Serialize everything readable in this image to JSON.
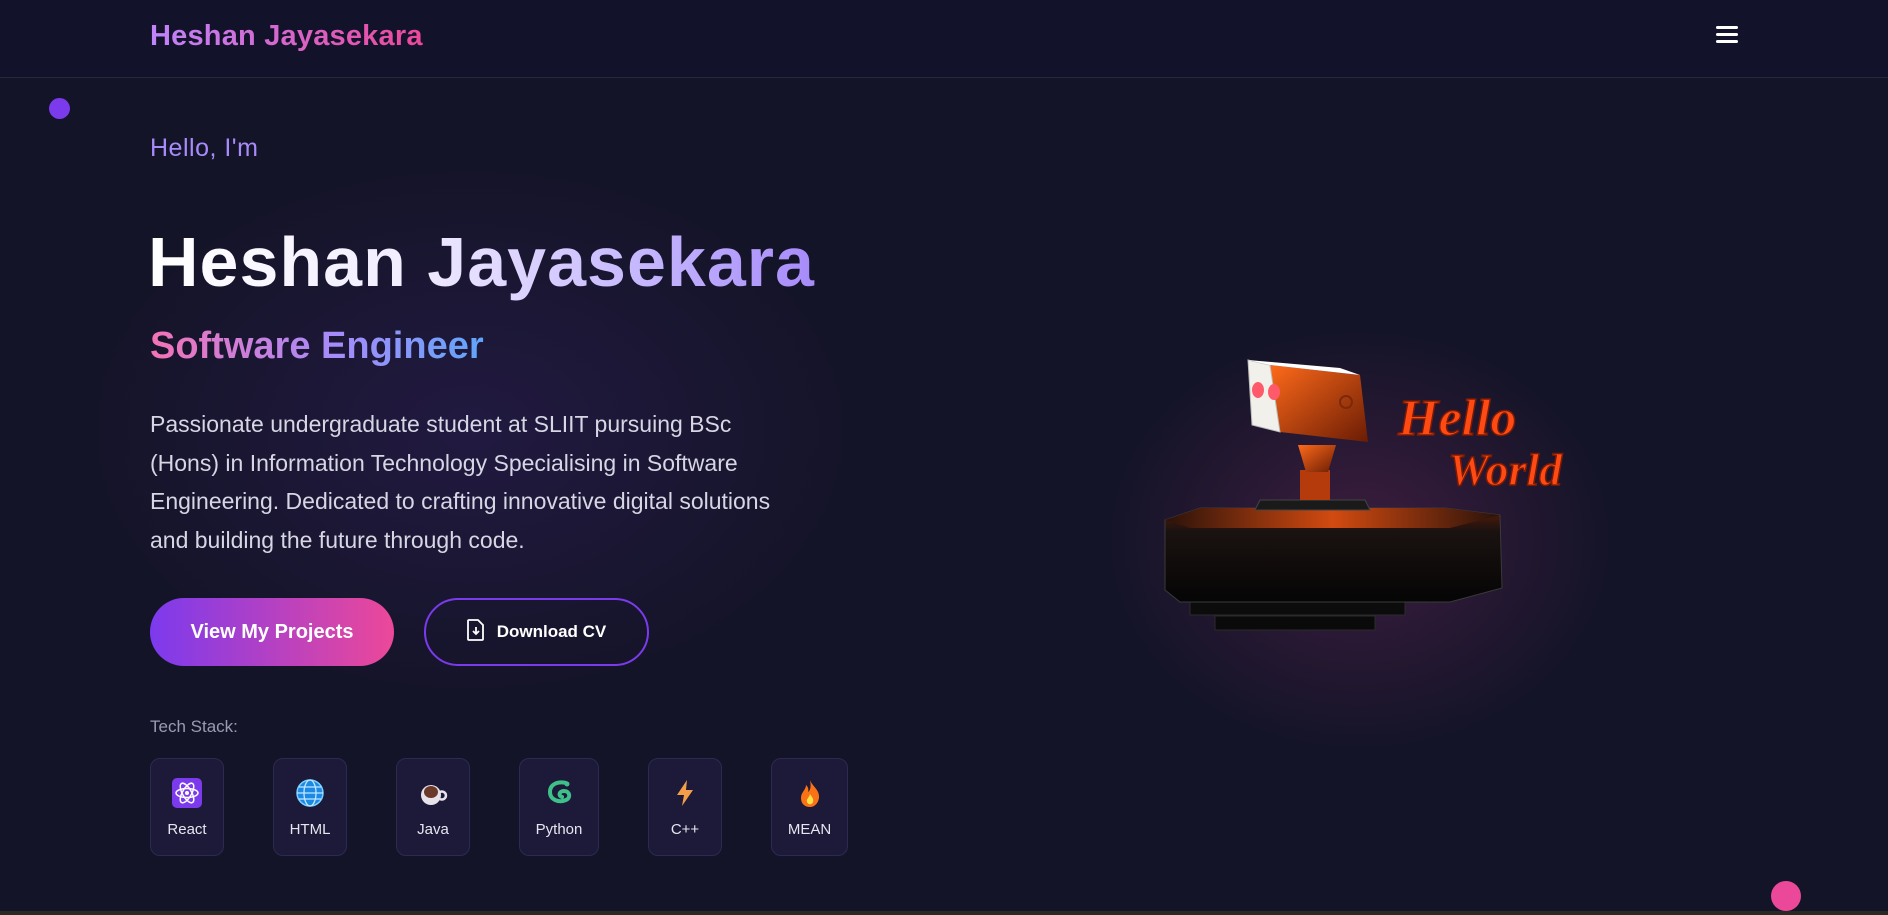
{
  "header": {
    "brand": "Heshan Jayasekara",
    "menu_icon": "hamburger-menu-icon"
  },
  "hero": {
    "greeting": "Hello, I'm",
    "name": "Heshan Jayasekara",
    "role": "Software Engineer",
    "description": "Passionate undergraduate student at SLIIT pursuing BSc (Hons) in Information Technology Specialising in Software Engineering. Dedicated to crafting innovative digital solutions and building the future through code.",
    "primary_button": "View My Projects",
    "secondary_button": "Download CV",
    "secondary_button_icon": "file-download-icon",
    "art_text_line1": "Hello",
    "art_text_line2": "World"
  },
  "tech_stack": {
    "label": "Tech Stack:",
    "items": [
      {
        "name": "React",
        "icon": "atom-icon"
      },
      {
        "name": "HTML",
        "icon": "globe-icon"
      },
      {
        "name": "Java",
        "icon": "coffee-cup-icon"
      },
      {
        "name": "Python",
        "icon": "snake-icon"
      },
      {
        "name": "C++",
        "icon": "lightning-icon"
      },
      {
        "name": "MEAN",
        "icon": "fire-icon"
      }
    ]
  },
  "colors": {
    "background": "#141428",
    "accent_purple": "#7c3aed",
    "accent_pink": "#ec4899",
    "greeting": "#a78bfa"
  }
}
